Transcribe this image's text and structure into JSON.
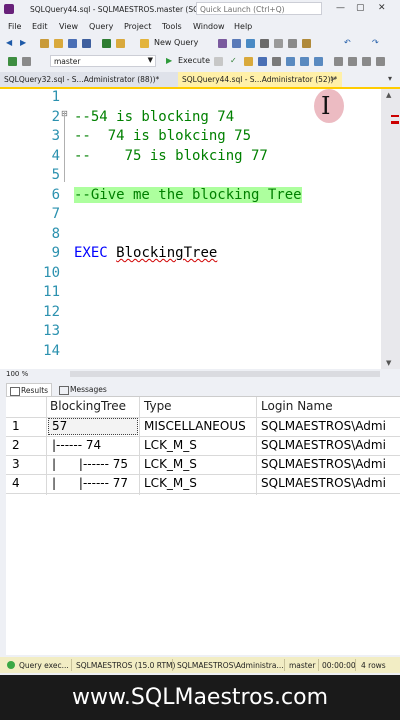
{
  "window": {
    "title": "SQLQuery44.sql - SQLMAESTROS.master (SQ...",
    "quick_launch_placeholder": "Quick Launch (Ctrl+Q)",
    "controls": [
      "—",
      "▢",
      "✕"
    ]
  },
  "menu": [
    "File",
    "Edit",
    "View",
    "Query",
    "Project",
    "Tools",
    "Window",
    "Help"
  ],
  "toolbar": {
    "new_query_label": "New Query",
    "database": "master",
    "execute_label": "Execute"
  },
  "tabs": [
    {
      "label": "SQLQuery32.sql - S...Administrator (88))*"
    },
    {
      "label": "SQLQuery44.sql - S...Administrator (52))*"
    }
  ],
  "editor": {
    "line_numbers": [
      "1",
      "2",
      "3",
      "4",
      "5",
      "6",
      "7",
      "8",
      "9",
      "10",
      "11",
      "12",
      "13",
      "14"
    ],
    "lines": {
      "l2": "--54 is blocking 74",
      "l3": "--  74 is blokcing 75",
      "l4": "--    75 is blokcing 77",
      "l6": "--Give me the blocking Tree",
      "l9_kw": "EXEC",
      "l9_ident": "BlockingTree"
    }
  },
  "zoom": "100 %",
  "results_tabs": {
    "results": "Results",
    "messages": "Messages"
  },
  "grid": {
    "columns": [
      "BlockingTree",
      "Type",
      "Login Name"
    ],
    "rows": [
      {
        "num": "1",
        "tree": "57",
        "type": "MISCELLANEOUS",
        "login": "SQLMAESTROS\\Admi"
      },
      {
        "num": "2",
        "tree": "|------ 74",
        "type": "LCK_M_S",
        "login": "SQLMAESTROS\\Admi"
      },
      {
        "num": "3",
        "tree": "|      |------ 75",
        "type": "LCK_M_S",
        "login": "SQLMAESTROS\\Admi"
      },
      {
        "num": "4",
        "tree": "|      |------ 77",
        "type": "LCK_M_S",
        "login": "SQLMAESTROS\\Admi"
      }
    ]
  },
  "status": {
    "query": "Query exec...",
    "server": "SQLMAESTROS (15.0 RTM)",
    "login": "SQLMAESTROS\\Administra...",
    "db": "master",
    "time": "00:00:00",
    "rows": "4 rows"
  },
  "footer": "www.SQLMaestros.com"
}
